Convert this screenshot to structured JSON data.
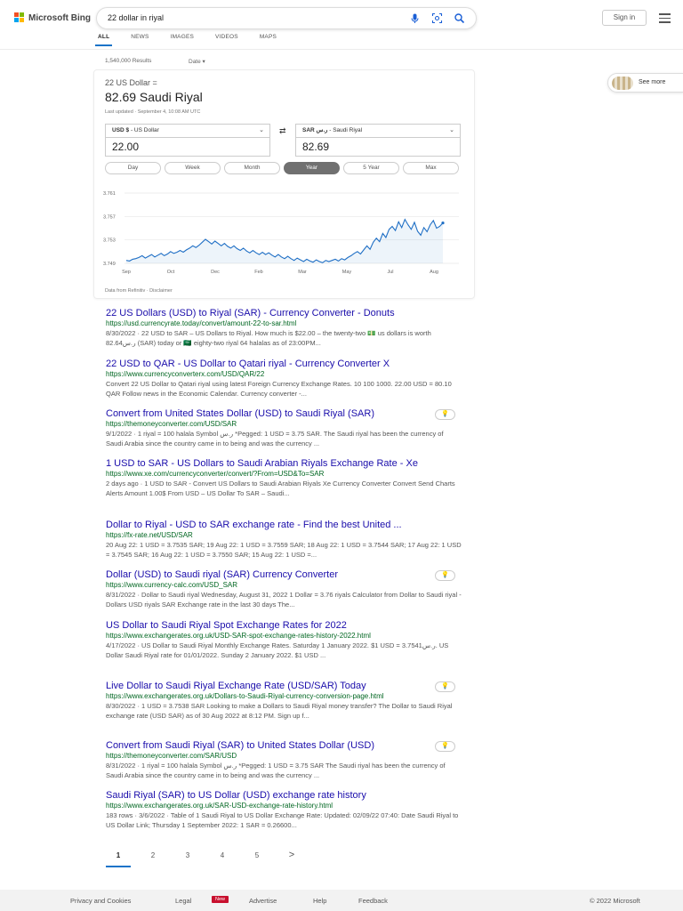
{
  "header": {
    "logo_text": "Microsoft Bing",
    "search_query": "22 dollar in riyal",
    "signin_label": "Sign in",
    "icons": [
      "mic-icon",
      "visual-search-icon",
      "search-icon",
      "hamburger-icon"
    ]
  },
  "tabs": [
    {
      "label": "ALL",
      "active": true
    },
    {
      "label": "NEWS",
      "active": false
    },
    {
      "label": "IMAGES",
      "active": false
    },
    {
      "label": "VIDEOS",
      "active": false
    },
    {
      "label": "MAPS",
      "active": false
    }
  ],
  "results_count": "1,540,000 Results",
  "date_filter": "Date ▾",
  "converter": {
    "from_line": "22 US Dollar =",
    "to_line": "82.69 Saudi Riyal",
    "updated": "Last updated · September 4, 10:08 AM UTC",
    "from_currency_code": "USD $",
    "from_currency_name": " - US Dollar",
    "to_currency_code": "SAR ر.س",
    "to_currency_name": " - Saudi Riyal",
    "from_amount": "22.00",
    "to_amount": "82.69",
    "ranges": [
      "Day",
      "Week",
      "Month",
      "Year",
      "5 Year",
      "Max"
    ],
    "active_range": "Year",
    "footer": "Data from Refinitiv · Disclaimer"
  },
  "see_more_label": "See more",
  "chart_data": {
    "type": "line",
    "y_ticks": [
      "3.761",
      "3.757",
      "3.753",
      "3.749"
    ],
    "x_ticks": [
      "Sep",
      "Oct",
      "Dec",
      "Feb",
      "Mar",
      "May",
      "Jul",
      "Aug"
    ],
    "ylim": [
      3.749,
      3.761
    ],
    "grid": true,
    "color": "#1f6fc5",
    "series": [
      {
        "values": [
          3.7495,
          3.7494,
          3.7497,
          3.7498,
          3.75,
          3.7503,
          3.7499,
          3.7502,
          3.7505,
          3.7501,
          3.7504,
          3.7507,
          3.7503,
          3.7506,
          3.751,
          3.7507,
          3.7509,
          3.7512,
          3.7509,
          3.7513,
          3.7516,
          3.752,
          3.7517,
          3.7521,
          3.7526,
          3.7531,
          3.7527,
          3.7523,
          3.7528,
          3.7524,
          3.752,
          3.7524,
          3.7519,
          3.7516,
          3.752,
          3.7515,
          3.7512,
          3.7516,
          3.7511,
          3.7508,
          3.7512,
          3.7508,
          3.7505,
          3.7509,
          3.7505,
          3.7508,
          3.7504,
          3.7501,
          3.7505,
          3.7501,
          3.7498,
          3.7502,
          3.7498,
          3.7495,
          3.7499,
          3.7496,
          3.7493,
          3.7497,
          3.7494,
          3.7492,
          3.7496,
          3.7493,
          3.7491,
          3.7495,
          3.7493,
          3.7495,
          3.7497,
          3.7494,
          3.7498,
          3.7496,
          3.75,
          3.7503,
          3.7507,
          3.751,
          3.7506,
          3.7513,
          3.752,
          3.7514,
          3.7526,
          3.7533,
          3.7527,
          3.7541,
          3.7534,
          3.7548,
          3.7553,
          3.7546,
          3.7561,
          3.7551,
          3.7565,
          3.7556,
          3.7548,
          3.756,
          3.7545,
          3.7538,
          3.7551,
          3.7544,
          3.7556,
          3.7563,
          3.755,
          3.7553,
          3.7559
        ]
      }
    ]
  },
  "results": [
    {
      "title": "22 US Dollars (USD) to Riyal (SAR) - Currency Converter - Donuts",
      "url": "https://usd.currencyrate.today/convert/amount-22-to-sar.html",
      "snippet": "8/30/2022 · 22 USD to SAR – US Dollars to Riyal. How much is $22.00 – the twenty-two 💵 us dollars is worth 82.64ر.س (SAR) today or 🇸🇦 eighty-two riyal 64 halalas as of 23:00PM...",
      "bulb": false
    },
    {
      "title": "22 USD to QAR - US Dollar to Qatari riyal - Currency Converter X",
      "url": "https://www.currencyconverterx.com/USD/QAR/22",
      "snippet": "Convert 22 US Dollar to Qatari riyal using latest Foreign Currency Exchange Rates. 10 100 1000. 22.00 USD = 80.10 QAR Follow news in the Economic Calendar. Currency converter -...",
      "bulb": false
    },
    {
      "title": "Convert from United States Dollar (USD) to Saudi Riyal (SAR)",
      "url": "https://themoneyconverter.com/USD/SAR",
      "snippet": "9/1/2022 · 1 riyal = 100 halala Symbol ر.س *Pegged: 1 USD = 3.75 SAR. The Saudi riyal has been the currency of Saudi Arabia since the country came in to being and was the currency ...",
      "bulb": true
    },
    {
      "title": "1 USD to SAR - US Dollars to Saudi Arabian Riyals Exchange Rate - Xe",
      "url": "https://www.xe.com/currencyconverter/convert/?From=USD&To=SAR",
      "snippet": "2 days ago · 1 USD to SAR - Convert US Dollars to Saudi Arabian Riyals Xe Currency Converter Convert Send Charts Alerts Amount 1.00$ From USD – US Dollar To SAR – Saudi...",
      "bulb": false
    },
    {
      "title": "Dollar to Riyal - USD to SAR exchange rate - Find the best United ...",
      "url": "https://fx-rate.net/USD/SAR",
      "snippet": "20 Aug 22: 1 USD = 3.7535 SAR; 19 Aug 22: 1 USD = 3.7559 SAR; 18 Aug 22: 1 USD = 3.7544 SAR; 17 Aug 22: 1 USD = 3.7545 SAR; 16 Aug 22: 1 USD = 3.7550 SAR; 15 Aug 22: 1 USD =...",
      "bulb": false
    },
    {
      "title": "Dollar (USD) to Saudi riyal (SAR) Currency Converter",
      "url": "https://www.currency-calc.com/USD_SAR",
      "snippet": "8/31/2022 · Dollar to Saudi riyal Wednesday, August 31, 2022 1 Dollar = 3.76 riyals Calculator from Dollar to Saudi riyal - Dollars USD riyals SAR Exchange rate in the last 30 days The...",
      "bulb": true
    },
    {
      "title": "US Dollar to Saudi Riyal Spot Exchange Rates for 2022",
      "url": "https://www.exchangerates.org.uk/USD-SAR-spot-exchange-rates-history-2022.html",
      "snippet": "4/17/2022 · US Dollar to Saudi Riyal Monthly Exchange Rates. Saturday 1 January 2022. $1 USD = 3.7541ر.س. US Dollar Saudi Riyal rate for 01/01/2022. Sunday 2 January 2022. $1 USD ...",
      "bulb": false
    },
    {
      "title": "Live Dollar to Saudi Riyal Exchange Rate (USD/SAR) Today",
      "url": "https://www.exchangerates.org.uk/Dollars-to-Saudi-Riyal-currency-conversion-page.html",
      "snippet": "8/30/2022 · 1 USD = 3.7538 SAR Looking to make a Dollars to Saudi Riyal money transfer? The Dollar to Saudi Riyal exchange rate (USD SAR) as of 30 Aug 2022 at 8:12 PM. Sign up f...",
      "bulb": true
    },
    {
      "title": "Convert from Saudi Riyal (SAR) to United States Dollar (USD)",
      "url": "https://themoneyconverter.com/SAR/USD",
      "snippet": "8/31/2022 · 1 riyal = 100 halala Symbol ر.س *Pegged: 1 USD = 3.75 SAR The Saudi riyal has been the currency of Saudi Arabia since the country came in to being and was the currency ...",
      "bulb": true
    },
    {
      "title": "Saudi Riyal (SAR) to US Dollar (USD) exchange rate history",
      "url": "https://www.exchangerates.org.uk/SAR-USD-exchange-rate-history.html",
      "snippet": "183 rows · 3/6/2022 · Table of 1 Saudi Riyal to US Dollar Exchange Rate: Updated: 02/09/22 07:40: Date Saudi Riyal to US Dollar Link; Thursday 1 September 2022: 1 SAR = 0.26600...",
      "bulb": false
    }
  ],
  "pagination": [
    "1",
    "2",
    "3",
    "4",
    "5",
    ">"
  ],
  "footer": {
    "privacy": "Privacy and Cookies",
    "legal": "Legal",
    "new_badge": "New",
    "advertise": "Advertise",
    "help": "Help",
    "feedback": "Feedback",
    "copyright": "© 2022 Microsoft"
  },
  "colors": {
    "link": "#1a0dab",
    "url": "#006621",
    "accent": "#1a73c8",
    "chart": "#1f6fc5"
  }
}
